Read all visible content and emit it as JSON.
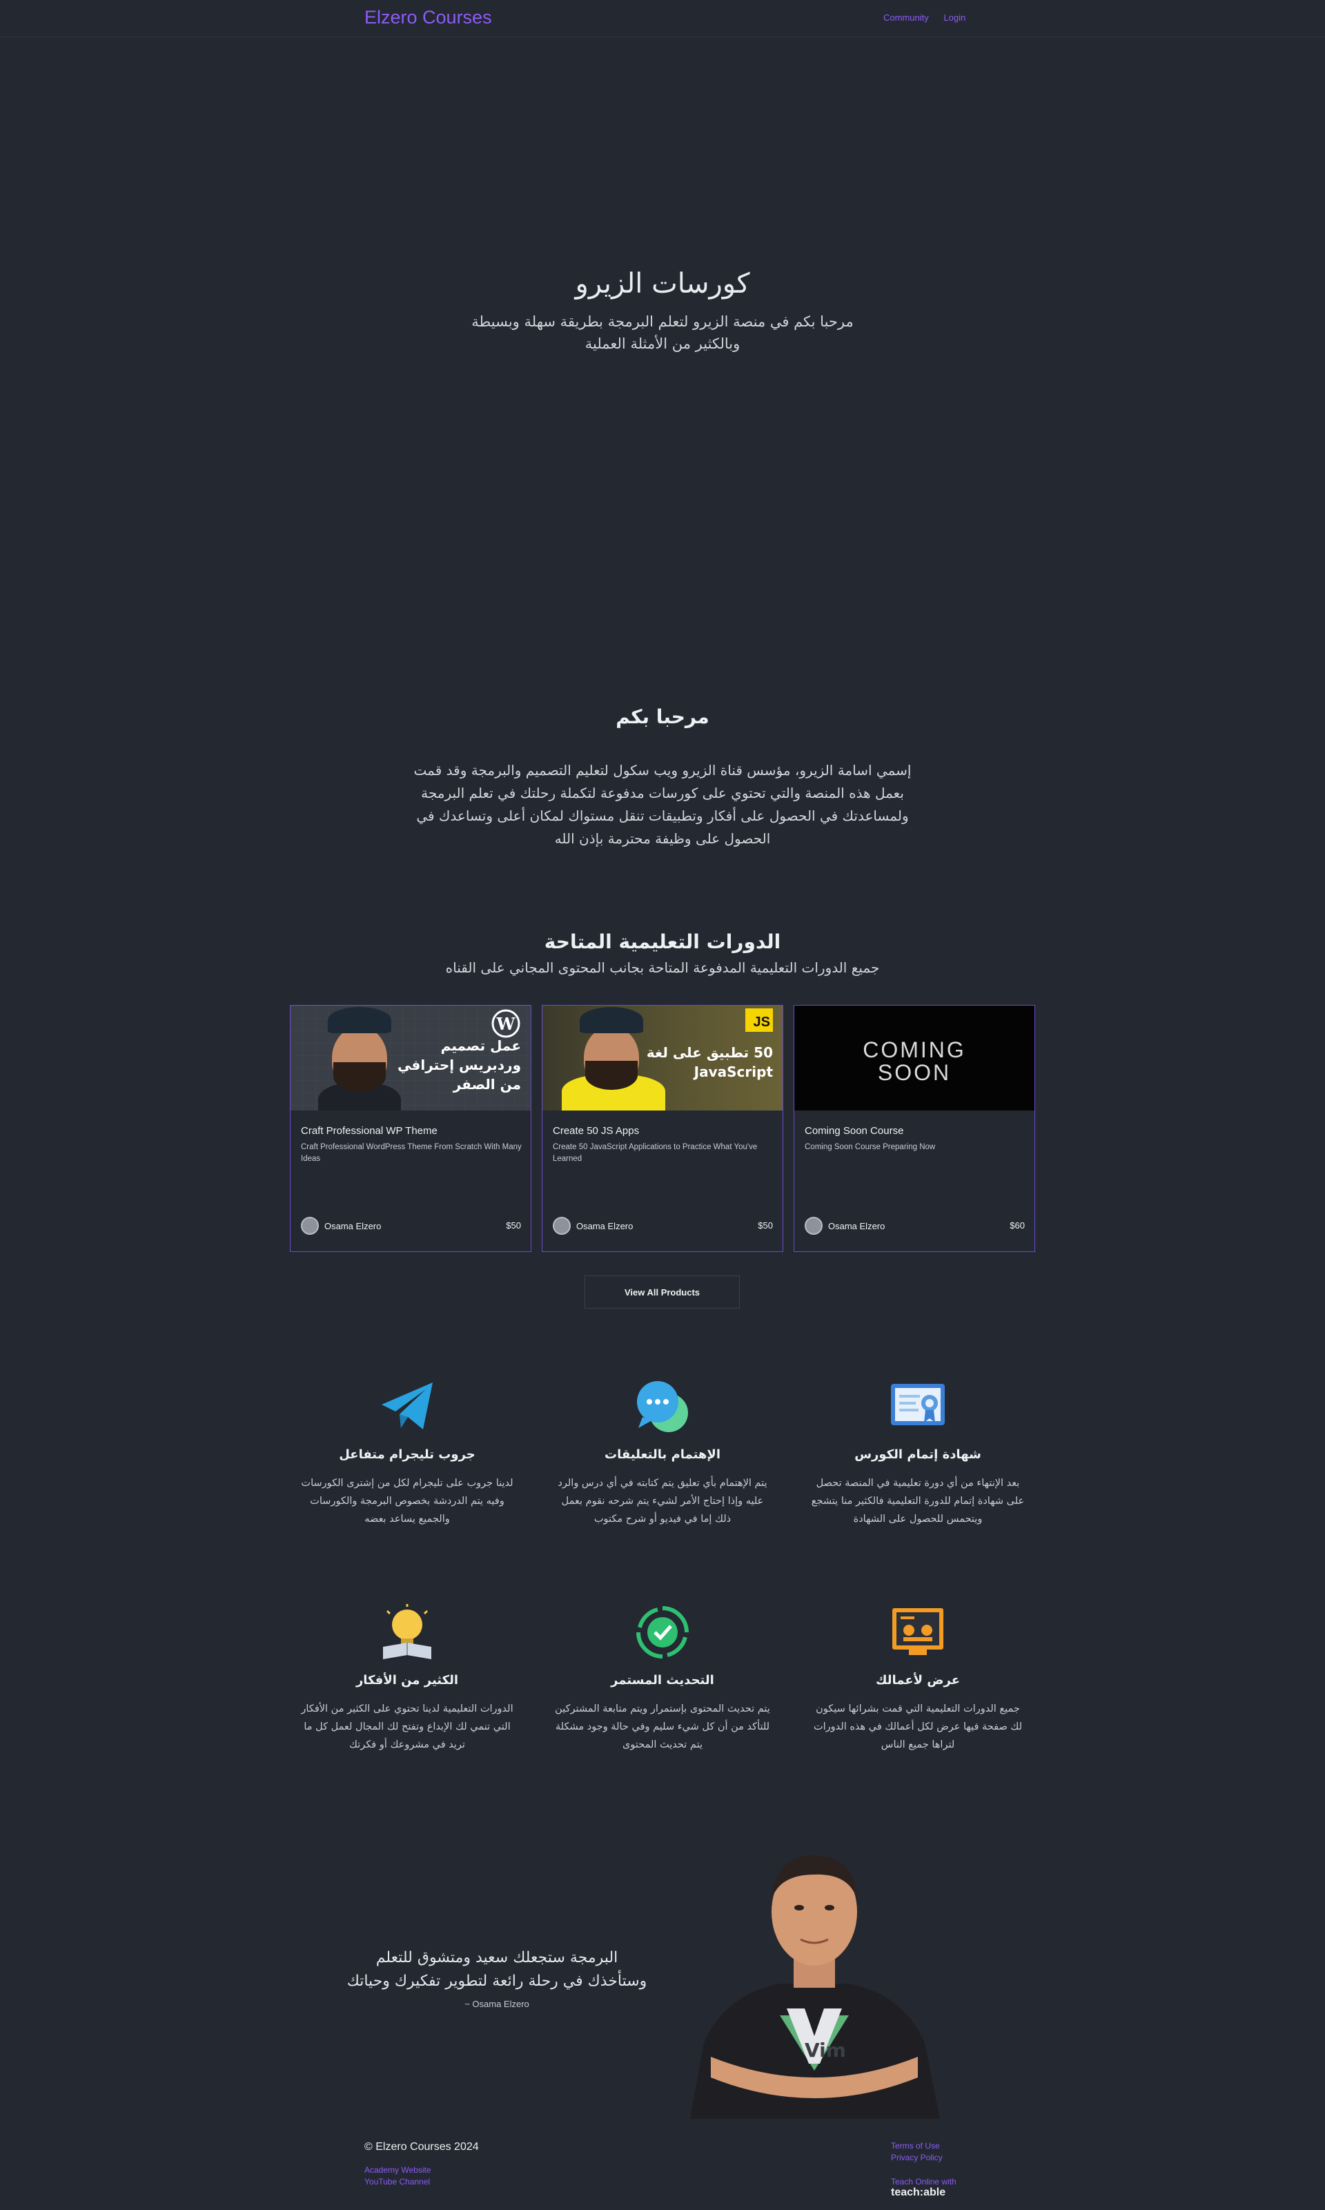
{
  "header": {
    "brand": "Elzero Courses",
    "nav": [
      "Community",
      "Login"
    ]
  },
  "hero": {
    "title": "كورسات الزيرو",
    "subtitle": "مرحبا بكم في منصة الزيرو لتعلم البرمجة بطريقة سهلة وبسيطة وبالكثير من الأمثلة العملية"
  },
  "welcome": {
    "title": "مرحبا بكم",
    "text": "إسمي اسامة الزيرو، مؤسس قناة الزيرو ويب سكول لتعليم التصميم والبرمجة وقد قمت بعمل هذه المنصة والتي تحتوي على كورسات مدفوعة لتكملة رحلتك في تعلم البرمجة ولمساعدتك في الحصول على أفكار وتطبيقات تنقل مستواك لمكان أعلى وتساعدك في الحصول على وظيفة محترمة بإذن الله"
  },
  "courses": {
    "title": "الدورات التعليمية المتاحة",
    "subtitle": "جميع الدورات التعليمية المدفوعة المتاحة بجانب المحتوى المجاني على القناه",
    "items": [
      {
        "title": "Craft Professional WP Theme",
        "description": "Craft Professional WordPress Theme From Scratch With Many Ideas",
        "thumb_text": "عمل تصميم وردبريس إحترافي من الصفر",
        "author": "Osama Elzero",
        "price": "$50"
      },
      {
        "title": "Create 50 JS Apps",
        "description": "Create 50 JavaScript Applications to Practice What You've Learned",
        "thumb_text": "50 تطبيق على لغة JavaScript",
        "badge": "JS",
        "author": "Osama Elzero",
        "price": "$50"
      },
      {
        "title": "Coming Soon Course",
        "description": "Coming Soon Course Preparing Now",
        "thumb_text": "COMING SOON",
        "author": "Osama Elzero",
        "price": "$60"
      }
    ],
    "view_all": "View All Products"
  },
  "features": [
    {
      "icon": "telegram-icon",
      "title": "جروب تليجرام متفاعل",
      "text": "لدينا جروب على تليجرام لكل من إشترى الكورسات وفيه يتم الدردشة بخصوص البرمجة والكورسات والجميع يساعد بعضه"
    },
    {
      "icon": "comments-icon",
      "title": "الإهتمام بالتعليقات",
      "text": "يتم الإهتمام بأي تعليق يتم كتابته في أي درس والرد عليه وإذا إحتاج الأمر لشيء يتم شرحه نقوم بعمل ذلك إما في فيديو أو شرح مكتوب"
    },
    {
      "icon": "certificate-icon",
      "title": "شهادة إتمام الكورس",
      "text": "بعد الإنتهاء من أي دورة تعليمية في المنصة تحصل على شهادة إتمام للدورة التعليمية فالكثير منا يتشجع ويتحمس للحصول على الشهادة"
    },
    {
      "icon": "lightbulb-icon",
      "title": "الكثير من الأفكار",
      "text": "الدورات التعليمية لدينا تحتوي على الكثير من الأفكار التي تنمي لك الإبداع وتفتح لك المجال لعمل كل ما تريد في مشروعك أو فكرتك"
    },
    {
      "icon": "refresh-icon",
      "title": "التحديث المستمر",
      "text": "يتم تحديث المحتوى بإستمرار ويتم متابعة المشتركين للتأكد من أن كل شيء سليم وفي حالة وجود مشكلة يتم تحديث المحتوى"
    },
    {
      "icon": "presentation-icon",
      "title": "عرض لأعمالك",
      "text": "جميع الدورات التعليمية التي قمت بشرائها سيكون لك صفحة فيها عرض لكل أعمالك في هذه الدورات لتراها جميع الناس"
    }
  ],
  "quote": {
    "text": "البرمجة ستجعلك سعيد ومتشوق للتعلم وستأخذك في رحلة رائعة لتطوير تفكيرك وحياتك",
    "author": "~ Osama Elzero"
  },
  "footer": {
    "copyright": "© Elzero Courses 2024",
    "left_links": [
      "Academy Website",
      "YouTube Channel"
    ],
    "right_links": [
      "Terms of Use",
      "Privacy Policy"
    ],
    "teach_label": "Teach Online with",
    "teach_brand": "teach:able"
  },
  "colors": {
    "background": "#232831",
    "accent": "#8d5cf6",
    "card_border": "#6d4bd1"
  }
}
